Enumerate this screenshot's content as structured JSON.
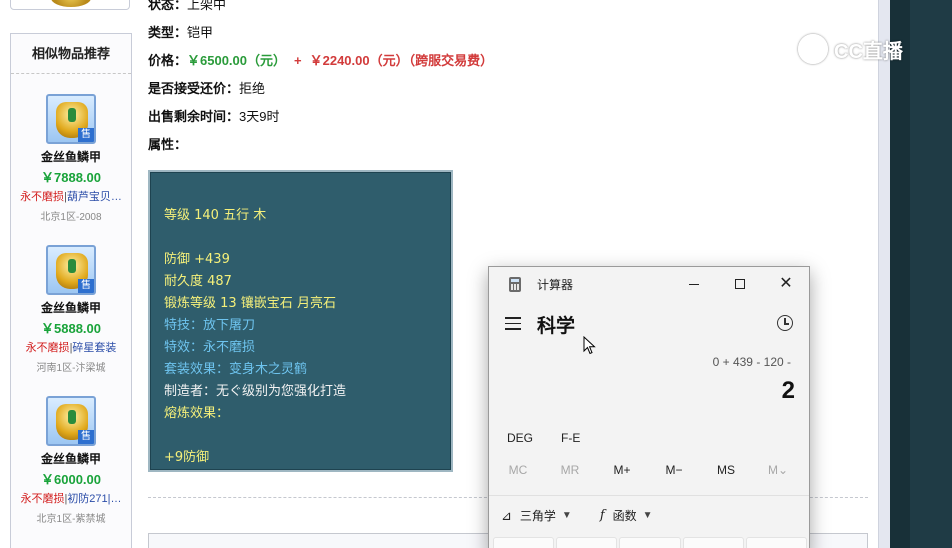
{
  "sidebar": {
    "title": "相似物品推荐",
    "items": [
      {
        "name": "金丝鱼鳞甲",
        "price": "￥7888.00",
        "tag1": "永不磨损",
        "tag2": "葫芦宝贝…",
        "server": "北京1区-2008",
        "badge": "售"
      },
      {
        "name": "金丝鱼鳞甲",
        "price": "￥5888.00",
        "tag1": "永不磨损",
        "tag2": "碎星套装",
        "server": "河南1区-汴梁城",
        "badge": "售"
      },
      {
        "name": "金丝鱼鳞甲",
        "price": "￥6000.00",
        "tag1": "永不磨损",
        "tag2": "初防271|…",
        "server": "北京1区-紫禁城",
        "badge": "售"
      }
    ]
  },
  "detail": {
    "status_label": "状态：",
    "status_value": "上架中",
    "type_label": "类型：",
    "type_value": "铠甲",
    "price_label": "价格：",
    "price_main": "￥6500.00（元）",
    "price_plus": "+",
    "price_fee": "￥2240.00（元）（跨服交易费）",
    "counter_label": "是否接受还价：",
    "counter_value": "拒绝",
    "time_label": "出售剩余时间：",
    "time_value": "3天9时",
    "attr_label": "属性："
  },
  "attributes": [
    {
      "text": "等级 140 五行 木",
      "color": "#f5f07a"
    },
    {
      "text": "防御 +439",
      "color": "#f5f07a"
    },
    {
      "text": "耐久度 487",
      "color": "#f5f07a"
    },
    {
      "text": "锻炼等级 13 镶嵌宝石 月亮石",
      "color": "#f5f07a"
    },
    {
      "text": "特技：放下屠刀",
      "color": "#6ec4ef"
    },
    {
      "text": "特效：永不磨损",
      "color": "#6ec4ef"
    },
    {
      "text": "套装效果：变身木之灵鹤",
      "color": "#6ec4ef"
    },
    {
      "text": "制造者：无ぐ级别为您强化打造",
      "color": "#f2f2f2"
    },
    {
      "text": "熔炼效果：",
      "color": "#f5f07a"
    },
    {
      "text": "+9防御",
      "color": "#f5f07a"
    }
  ],
  "watermark": {
    "text": "CC直播"
  },
  "calculator": {
    "title": "计算器",
    "mode": "科学",
    "expression": "0 + 439 - 120 -",
    "result": "2",
    "angle": "DEG",
    "fe": "F-E",
    "memory": [
      "MC",
      "MR",
      "M+",
      "M−",
      "MS",
      "M⌄"
    ],
    "trig_label": "三角学",
    "func_label": "函数"
  }
}
